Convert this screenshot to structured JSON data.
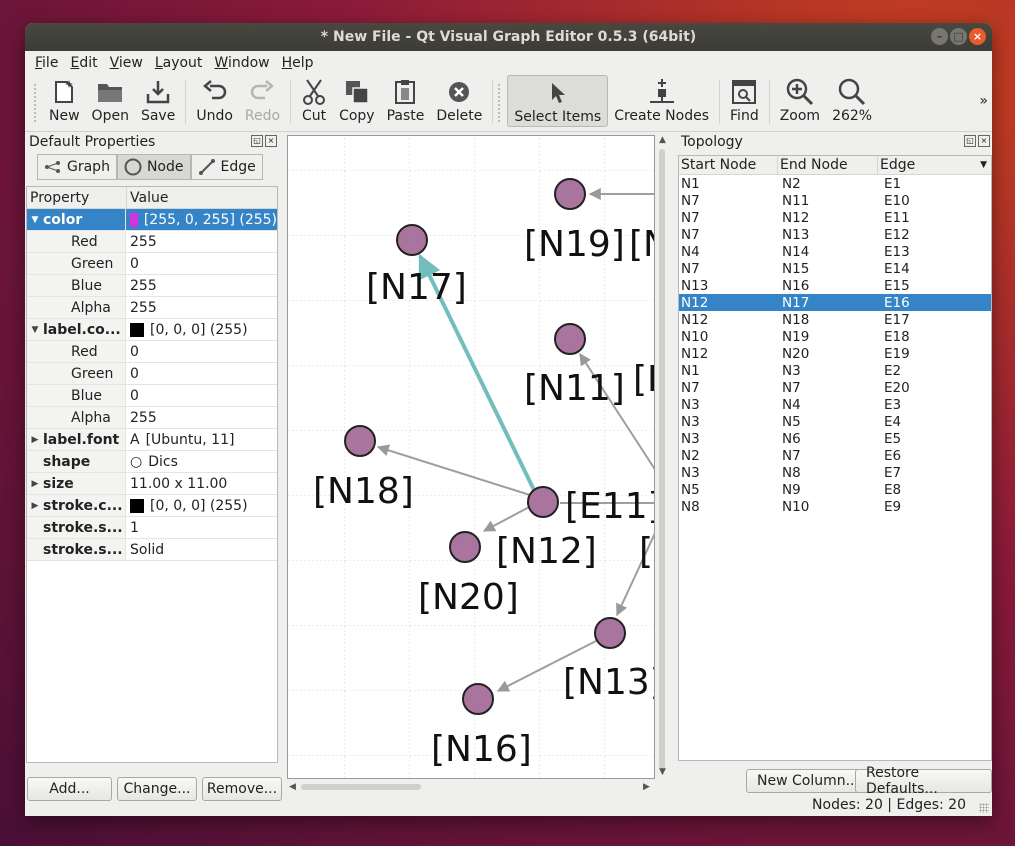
{
  "window": {
    "title": "* New File - Qt Visual Graph Editor 0.5.3 (64bit)"
  },
  "menu": [
    "File",
    "Edit",
    "View",
    "Layout",
    "Window",
    "Help"
  ],
  "toolbar": {
    "new": "New",
    "open": "Open",
    "save": "Save",
    "undo": "Undo",
    "redo": "Redo",
    "cut": "Cut",
    "copy": "Copy",
    "paste": "Paste",
    "delete": "Delete",
    "select_items": "Select Items",
    "create_nodes": "Create Nodes",
    "find": "Find",
    "zoom": "Zoom",
    "zoom_level": "262%",
    "more": "»"
  },
  "properties": {
    "title": "Default Properties",
    "tabs": [
      "Graph",
      "Node",
      "Edge"
    ],
    "header": [
      "Property",
      "Value"
    ],
    "rows": [
      {
        "k": "color",
        "v": "[255, 0, 255] (255)",
        "swatch": "#d433e0"
      },
      {
        "k": "Red",
        "v": "255"
      },
      {
        "k": "Green",
        "v": "0"
      },
      {
        "k": "Blue",
        "v": "255"
      },
      {
        "k": "Alpha",
        "v": "255"
      },
      {
        "k": "label.co...",
        "v": "[0, 0, 0] (255)",
        "swatch": "#000000"
      },
      {
        "k": "Red",
        "v": "0"
      },
      {
        "k": "Green",
        "v": "0"
      },
      {
        "k": "Blue",
        "v": "0"
      },
      {
        "k": "Alpha",
        "v": "255"
      },
      {
        "k": "label.font",
        "v": "[Ubuntu, 11]",
        "glyph": "A"
      },
      {
        "k": "shape",
        "v": "Dics",
        "glyph": "○"
      },
      {
        "k": "size",
        "v": "11.00 x 11.00"
      },
      {
        "k": "stroke.c...",
        "v": "[0, 0, 0] (255)",
        "swatch": "#000000"
      },
      {
        "k": "stroke.s...",
        "v": "1"
      },
      {
        "k": "stroke.s...",
        "v": "Solid"
      }
    ],
    "buttons": [
      "Add...",
      "Change...",
      "Remove..."
    ]
  },
  "canvas": {
    "nodes": [
      {
        "id": "N19",
        "label": "[N19]"
      },
      {
        "id": "N17",
        "label": "[N17]"
      },
      {
        "id": "N11",
        "label": "[N11]"
      },
      {
        "id": "N18",
        "label": "[N18]"
      },
      {
        "id": "N12",
        "label": "[N12]"
      },
      {
        "id": "N20",
        "label": "[N20]"
      },
      {
        "id": "N13",
        "label": "[N13]"
      },
      {
        "id": "N16",
        "label": "[N16]"
      }
    ],
    "edge_label": "[E11]",
    "partial_labels": [
      "[N",
      "[E",
      "["
    ],
    "node_fill": "#a9749d",
    "highlight_edge_color": "#74bdbd"
  },
  "topology": {
    "title": "Topology",
    "columns": [
      "Start Node",
      "End Node",
      "Edge"
    ],
    "rows": [
      [
        "N1",
        "N2",
        "E1"
      ],
      [
        "N7",
        "N11",
        "E10"
      ],
      [
        "N7",
        "N12",
        "E11"
      ],
      [
        "N7",
        "N13",
        "E12"
      ],
      [
        "N4",
        "N14",
        "E13"
      ],
      [
        "N7",
        "N15",
        "E14"
      ],
      [
        "N13",
        "N16",
        "E15"
      ],
      [
        "N12",
        "N17",
        "E16"
      ],
      [
        "N12",
        "N18",
        "E17"
      ],
      [
        "N10",
        "N19",
        "E18"
      ],
      [
        "N12",
        "N20",
        "E19"
      ],
      [
        "N1",
        "N3",
        "E2"
      ],
      [
        "N7",
        "N7",
        "E20"
      ],
      [
        "N3",
        "N4",
        "E3"
      ],
      [
        "N3",
        "N5",
        "E4"
      ],
      [
        "N3",
        "N6",
        "E5"
      ],
      [
        "N2",
        "N7",
        "E6"
      ],
      [
        "N3",
        "N8",
        "E7"
      ],
      [
        "N5",
        "N9",
        "E8"
      ],
      [
        "N8",
        "N10",
        "E9"
      ]
    ],
    "selected_index": 7,
    "buttons": [
      "New Column...",
      "Restore Defaults..."
    ]
  },
  "status": "Nodes: 20 | Edges: 20"
}
